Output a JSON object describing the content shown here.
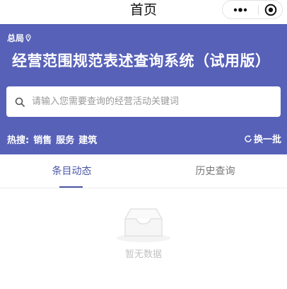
{
  "nav": {
    "title": "首页",
    "more_icon": "more-dots-icon",
    "close_icon": "target-close-icon"
  },
  "hero": {
    "location_label": "总局",
    "location_icon": "location-pin-icon",
    "title": "经营范围规范表述查询系统（试用版）",
    "background_color": "#5761b8"
  },
  "search": {
    "icon": "search-icon",
    "placeholder": "请输入您需要查询的经营活动关键词",
    "value": ""
  },
  "hot": {
    "label": "热搜:",
    "keywords": [
      "销售",
      "服务",
      "建筑"
    ],
    "refresh_icon": "refresh-icon",
    "refresh_label": "换一批"
  },
  "tabs": [
    {
      "label": "条目动态",
      "active": true
    },
    {
      "label": "历史查询",
      "active": false
    }
  ],
  "accent_color": "#4a56a6",
  "empty_state": {
    "icon": "empty-inbox-icon",
    "text": "暂无数据"
  }
}
